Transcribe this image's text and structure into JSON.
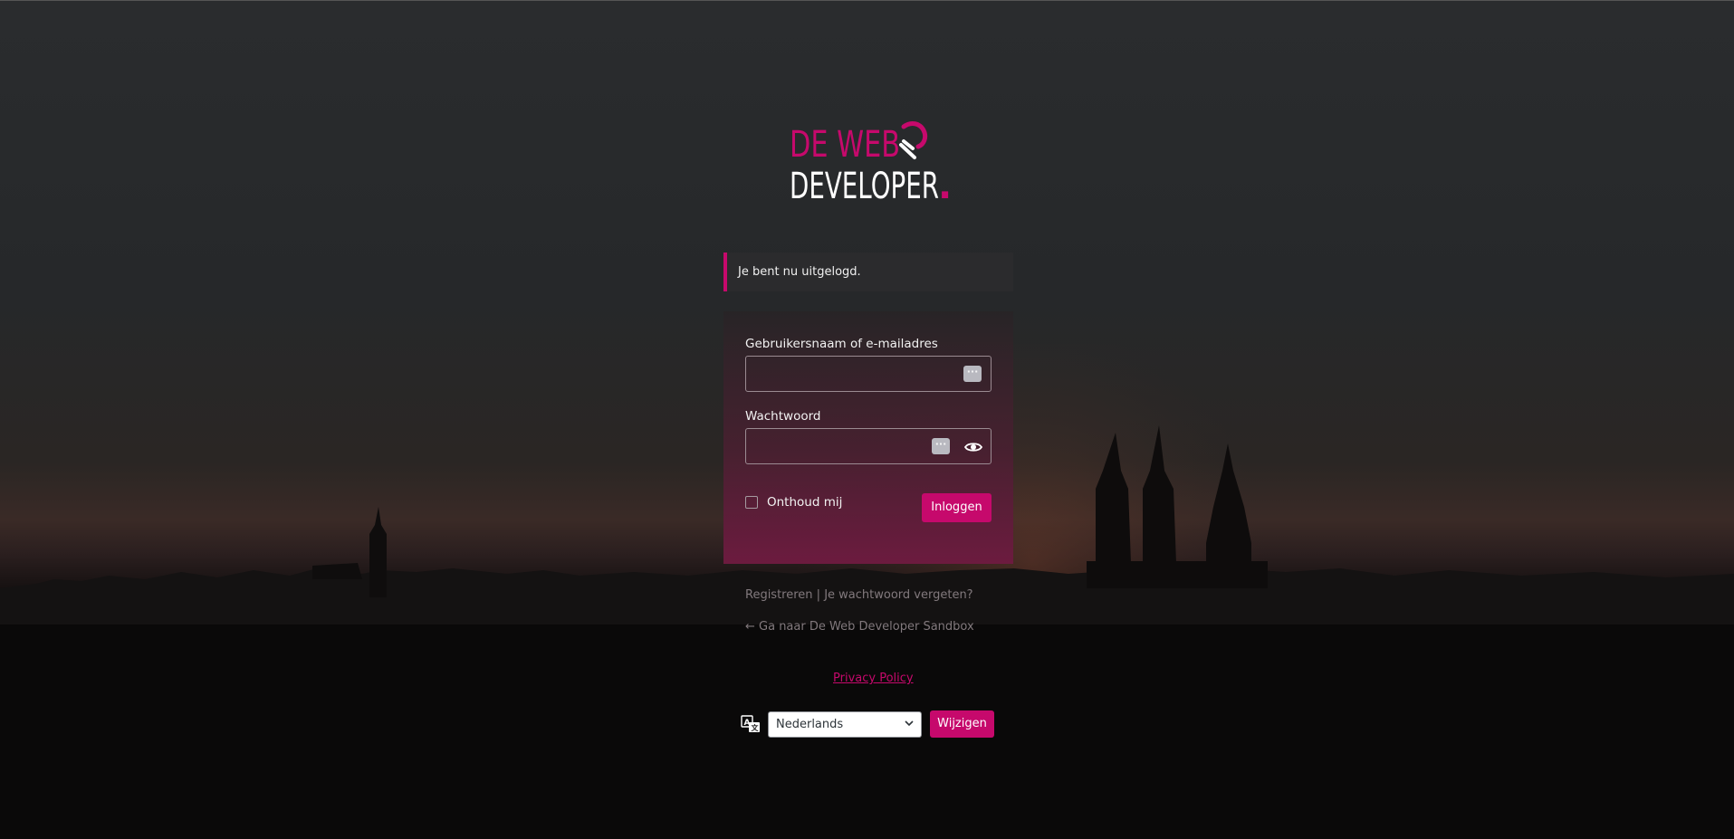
{
  "logo": {
    "line1": "DE WEB",
    "line2": "DEVELOPER",
    "dot": "."
  },
  "notice": {
    "text": "Je bent nu uitgelogd."
  },
  "login_form": {
    "username_label": "Gebruikersnaam of e-mailadres",
    "username_value": "",
    "password_label": "Wachtwoord",
    "password_value": "",
    "remember_label": "Onthoud mij",
    "remember_checked": false,
    "submit_label": "Inloggen"
  },
  "nav": {
    "register": "Registreren",
    "separator": " | ",
    "lost_password": "Je wachtwoord vergeten?",
    "back_to_site": "← Ga naar De Web Developer Sandbox"
  },
  "privacy": {
    "label": "Privacy Policy"
  },
  "language": {
    "selected": "Nederlands",
    "change_label": "Wijzigen"
  },
  "colors": {
    "accent": "#c6096c",
    "background": "#2a2c2e",
    "text": "#f2f2f2",
    "muted": "#82797d"
  },
  "icons": {
    "password_manager": "password-manager-icon",
    "eye": "eye-icon",
    "translate": "translate-icon",
    "chevron": "chevron-down-icon"
  }
}
